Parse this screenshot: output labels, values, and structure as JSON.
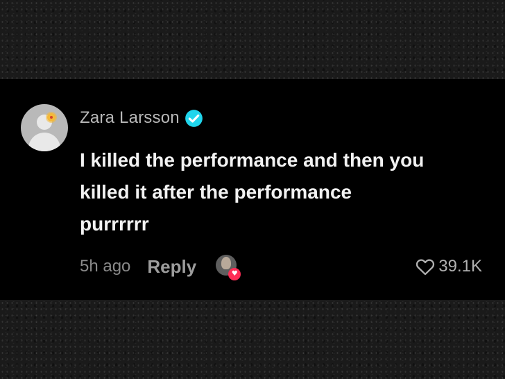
{
  "comment": {
    "username": "Zara Larsson",
    "verified": true,
    "text_lines": [
      "I killed the performance and then you",
      "killed it after the performance",
      "purrrrrr"
    ],
    "time_ago": "5h ago",
    "reply_label": "Reply",
    "like_count": "39.1K",
    "creator_liked": true
  },
  "colors": {
    "card_background": "#000000",
    "verified_badge": "#20d5ec",
    "creator_heart_badge": "#fe2c55",
    "username_text": "#b8b8b8",
    "comment_text": "#f2f2f2",
    "meta_text": "#8a8a8a"
  },
  "icons": {
    "verified": "verified-check-icon",
    "like": "heart-outline-icon",
    "creator_liked": "heart-badge-icon"
  }
}
